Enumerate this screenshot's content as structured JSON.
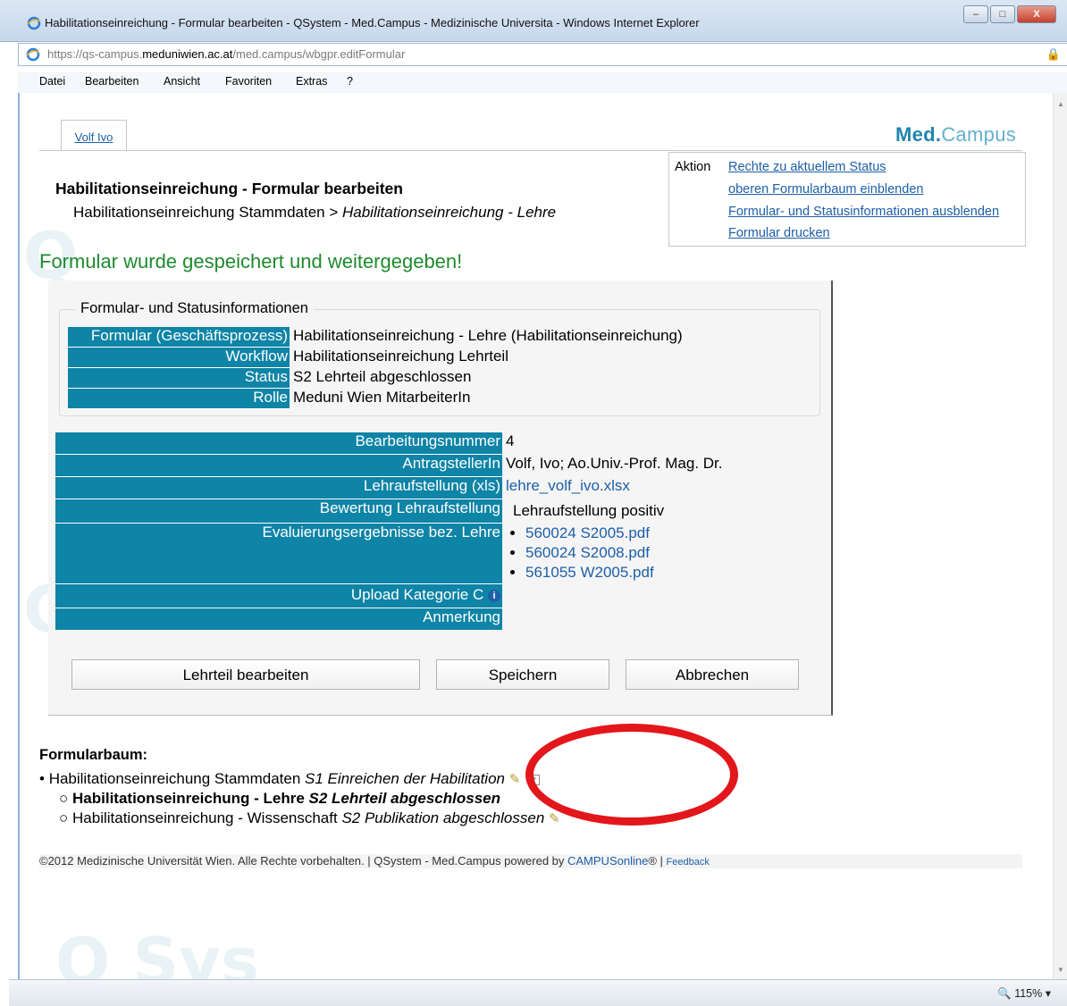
{
  "window": {
    "title": "Habilitationseinreichung - Formular bearbeiten - QSystem - Med.Campus - Medizinische Universita - Windows Internet Explorer",
    "minimize": "–",
    "maximize": "□",
    "close": "X"
  },
  "address": {
    "prefix": "https://qs-campus.",
    "domain": "meduniwien.ac.at",
    "path": "/med.campus/wbgpr.editFormular"
  },
  "menu": [
    "Datei",
    "Bearbeiten",
    "Ansicht",
    "Favoriten",
    "Extras",
    "?"
  ],
  "user_tab": "Volf Ivo",
  "logo": {
    "part1": "Med.",
    "part2": "Campus"
  },
  "page": {
    "heading": "Habilitationseinreichung - Formular bearbeiten",
    "breadcrumb_parent": "Habilitationseinreichung Stammdaten >",
    "breadcrumb_current": "Habilitationseinreichung - Lehre",
    "success": "Formular wurde gespeichert und weitergegeben!"
  },
  "actions": {
    "label": "Aktion",
    "links": [
      "Rechte zu aktuellem Status",
      "oberen Formularbaum einblenden",
      "Formular- und Statusinformationen ausblenden",
      "Formular drucken"
    ]
  },
  "form_info": {
    "legend": "Formular- und Statusinformationen",
    "rows": [
      {
        "label": "Formular (Geschäftsprozess)",
        "value": "Habilitationseinreichung - Lehre (Habilitationseinreichung)"
      },
      {
        "label": "Workflow",
        "value": "Habilitationseinreichung Lehrteil"
      },
      {
        "label": "Status",
        "value": "S2 Lehrteil abgeschlossen"
      },
      {
        "label": "Rolle",
        "value": "Meduni Wien MitarbeiterIn"
      }
    ]
  },
  "details": {
    "bearbeitungsnummer": {
      "label": "Bearbeitungsnummer",
      "value": "4"
    },
    "antragsteller": {
      "label": "AntragstellerIn",
      "value": "Volf, Ivo; Ao.Univ.-Prof. Mag. Dr."
    },
    "lehraufstellung": {
      "label": "Lehraufstellung (xls)",
      "value": "lehre_volf_ivo.xlsx"
    },
    "bewertung": {
      "label": "Bewertung Lehraufstellung",
      "value": "Lehraufstellung positiv"
    },
    "evaluierung": {
      "label": "Evaluierungsergebnisse bez. Lehre",
      "files": [
        "560024 S2005.pdf",
        "560024 S2008.pdf",
        "561055 W2005.pdf"
      ]
    },
    "upload": {
      "label": "Upload Kategorie C",
      "icon": "i"
    },
    "anmerkung": {
      "label": "Anmerkung"
    }
  },
  "buttons": {
    "lehrteil": "Lehrteil bearbeiten",
    "speichern": "Speichern",
    "abbrechen": "Abbrechen"
  },
  "tree": {
    "title": "Formularbaum:",
    "items": [
      {
        "name": "Habilitationseinreichung Stammdaten",
        "status": "S1 Einreichen der Habilitation"
      },
      {
        "name": "Habilitationseinreichung - Lehre",
        "status": "S2 Lehrteil abgeschlossen"
      },
      {
        "name": "Habilitationseinreichung - Wissenschaft",
        "status": "S2 Publikation abgeschlossen"
      }
    ]
  },
  "footer": {
    "text": "©2012 Medizinische Universität Wien. Alle Rechte vorbehalten. | QSystem - Med.Campus powered by ",
    "campus_link": "CAMPUSonline",
    "reg": "® | ",
    "feedback": "Feedback"
  },
  "statusbar": {
    "zoom": "115%"
  },
  "colors": {
    "label_bg": "#0e84a6",
    "link": "#1d5fa8",
    "success": "#1f8a2e",
    "highlight": "#e3161b"
  }
}
